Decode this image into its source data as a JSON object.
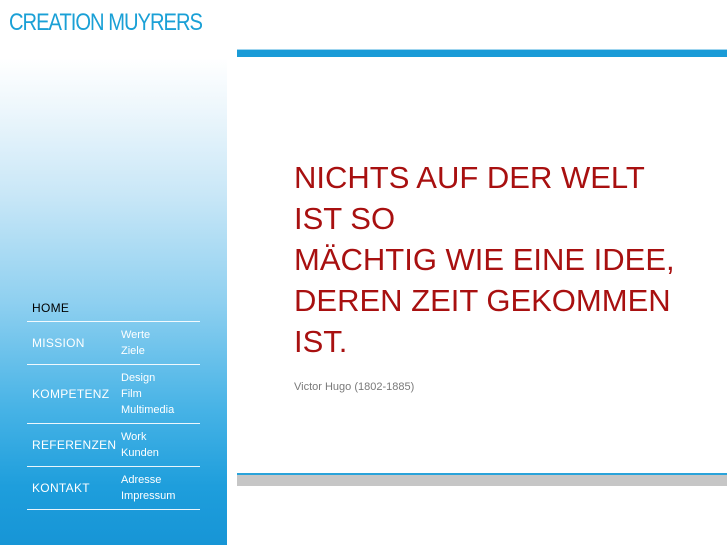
{
  "logo": {
    "text": "CREATION MUYRERS",
    "icon": "cm-logo-mark-icon",
    "color": "#1aa0d6"
  },
  "nav": {
    "home": {
      "label": "HOME"
    },
    "mission": {
      "label": "MISSION",
      "subs": [
        "Werte",
        "Ziele"
      ]
    },
    "kompetenz": {
      "label": "KOMPETENZ",
      "subs": [
        "Design",
        "Film",
        "Multimedia"
      ]
    },
    "referenzen": {
      "label": "REFERENZEN",
      "subs": [
        "Work",
        "Kunden"
      ]
    },
    "kontakt": {
      "label": "KONTAKT",
      "subs": [
        "Adresse",
        "Impressum"
      ]
    }
  },
  "quote": {
    "lines": [
      "NICHTS AUF DER WELT",
      "IST SO",
      "MÄCHTIG WIE EINE IDEE,",
      "DEREN ZEIT GEKOMMEN",
      "IST."
    ],
    "author": "Victor Hugo (1802-1885)",
    "color": "#a81010"
  },
  "colors": {
    "accent": "#1a9bd7",
    "bar_gray": "#c6c6c6"
  }
}
